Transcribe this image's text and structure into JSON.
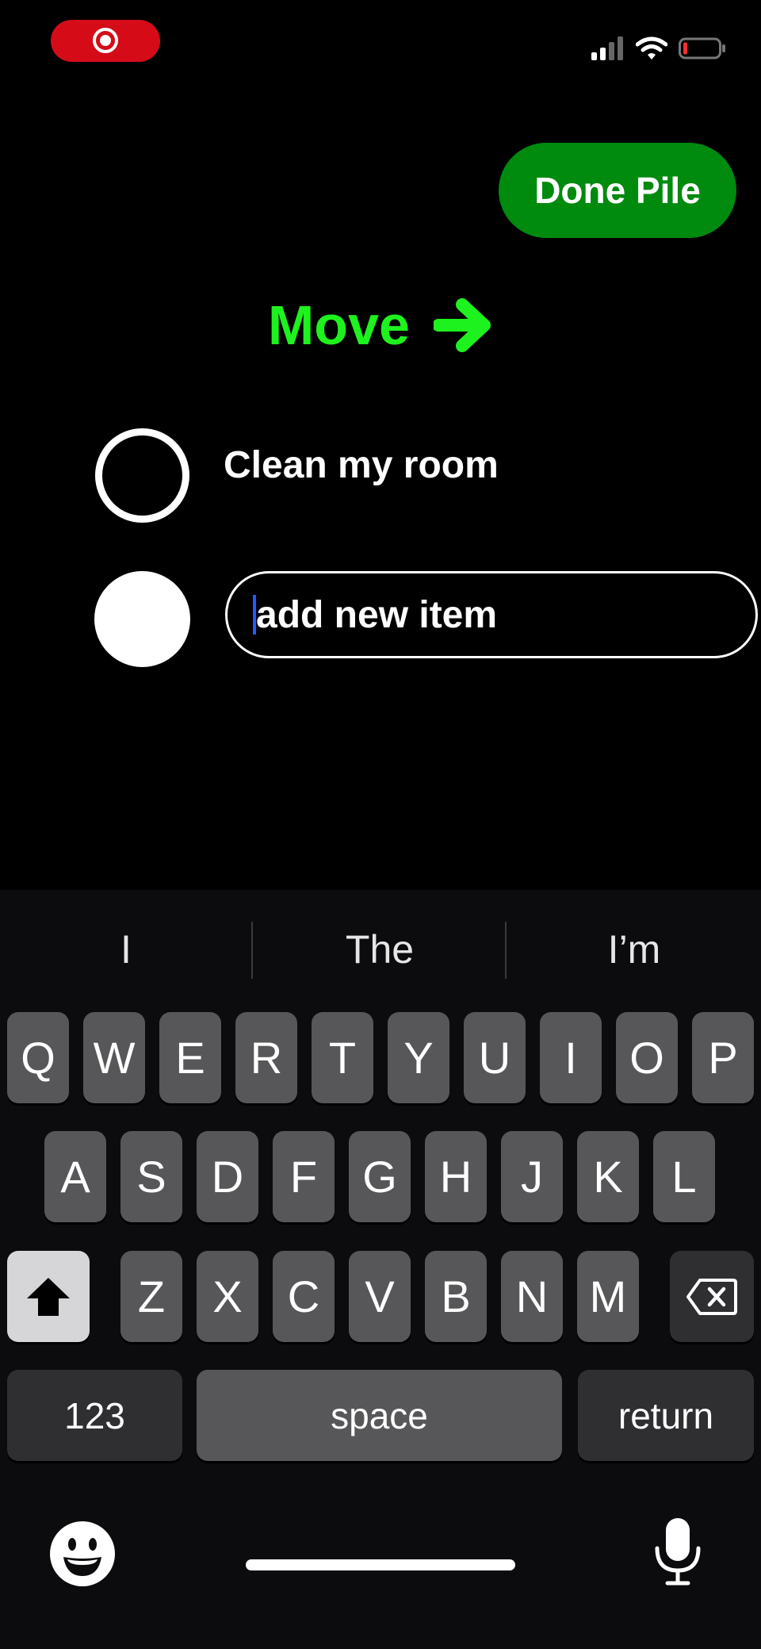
{
  "status_bar": {
    "recording_icon": "screen-recording-icon",
    "signal_icon": "cellular-signal-icon",
    "wifi_icon": "wifi-icon",
    "battery_icon": "battery-low-icon"
  },
  "header": {
    "done_pile_label": "Done Pile"
  },
  "move": {
    "label": "Move",
    "icon": "arrow-right-icon",
    "color": "#1ef21e"
  },
  "list": {
    "items": [
      {
        "text": "Clean my room",
        "checked": false
      }
    ],
    "new_item_placeholder": "add new item"
  },
  "keyboard": {
    "suggestions": [
      "I",
      "The",
      "I’m"
    ],
    "row1": [
      "Q",
      "W",
      "E",
      "R",
      "T",
      "Y",
      "U",
      "I",
      "O",
      "P"
    ],
    "row2": [
      "A",
      "S",
      "D",
      "F",
      "G",
      "H",
      "J",
      "K",
      "L"
    ],
    "row3": [
      "Z",
      "X",
      "C",
      "V",
      "B",
      "N",
      "M"
    ],
    "numbers_label": "123",
    "space_label": "space",
    "return_label": "return",
    "emoji_icon": "emoji-icon",
    "mic_icon": "microphone-icon"
  },
  "colors": {
    "accent_green": "#008a0e",
    "move_green": "#1ef21e",
    "recording_red": "#d50b18"
  }
}
